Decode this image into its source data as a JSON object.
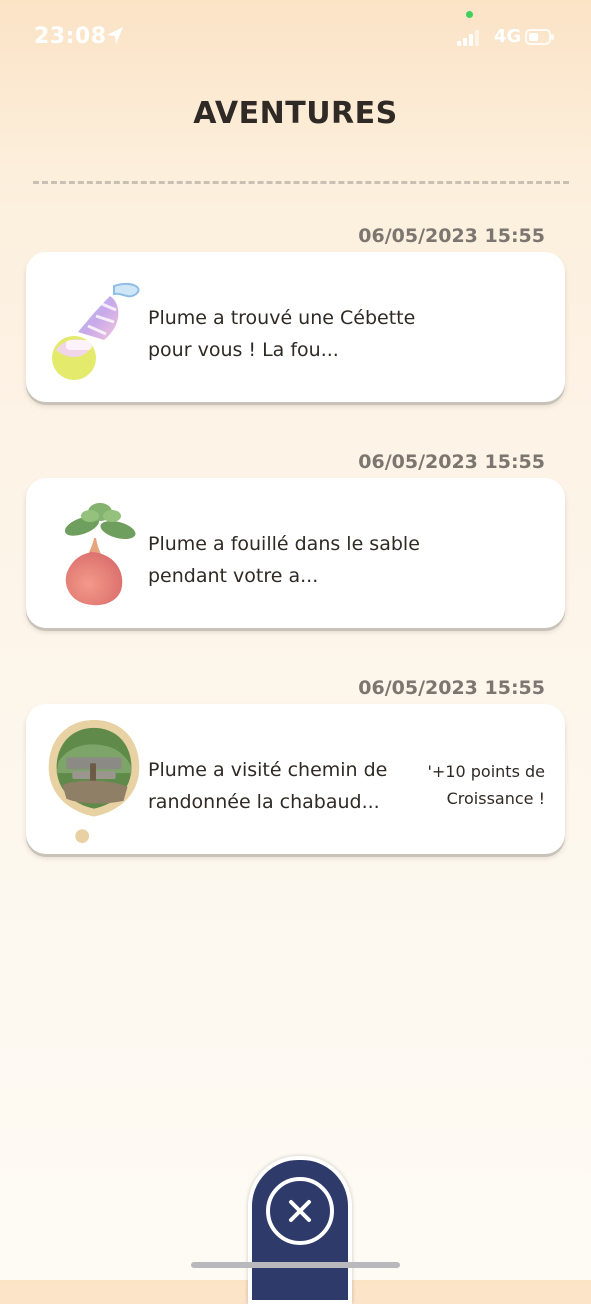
{
  "status_bar": {
    "time": "23:08",
    "network": "4G"
  },
  "header": {
    "title": "AVENTURES"
  },
  "entries": [
    {
      "date": "06/05/2023 15:55",
      "text": "Plume a trouvé une Cébette pour vous ! La fou...",
      "icon": "cebette-icon"
    },
    {
      "date": "06/05/2023 15:55",
      "text": "Plume a fouillé dans le sable pendant votre a...",
      "icon": "bulb-plant-icon"
    },
    {
      "date": "06/05/2023 15:55",
      "text": "Plume a visité chemin de randonnée la chabaud...",
      "bonus": "'+10 points de Croissance !",
      "icon": "location-photo-icon"
    }
  ],
  "footer": {
    "close_icon": "close-icon"
  },
  "colors": {
    "accent": "#2d3a6a",
    "background": "#fdf3e6",
    "date_text": "#7c7670"
  }
}
